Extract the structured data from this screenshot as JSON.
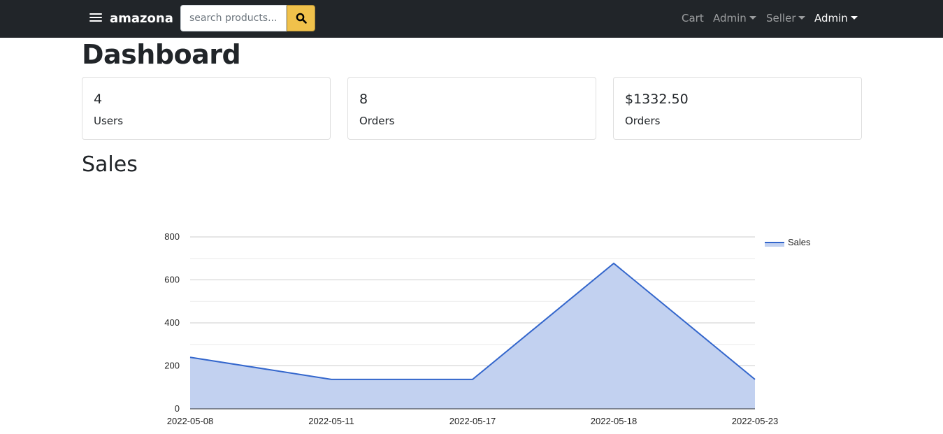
{
  "navbar": {
    "brand": "amazona",
    "search_placeholder": "search products...",
    "links": {
      "cart": "Cart",
      "admin_menu_1": "Admin",
      "seller_menu": "Seller",
      "admin_menu_2": "Admin"
    }
  },
  "page": {
    "title": "Dashboard",
    "sales_heading": "Sales"
  },
  "cards": [
    {
      "value": "4",
      "label": "Users"
    },
    {
      "value": "8",
      "label": "Orders"
    },
    {
      "value": "$1332.50",
      "label": "Orders"
    }
  ],
  "chart_data": {
    "type": "area",
    "categories": [
      "2022-05-08",
      "2022-05-11",
      "2022-05-17",
      "2022-05-18",
      "2022-05-23"
    ],
    "series": [
      {
        "name": "Sales",
        "values": [
          240,
          137,
          137,
          677,
          137
        ]
      }
    ],
    "ylim": [
      0,
      800
    ],
    "yticks": [
      0,
      200,
      400,
      600,
      800
    ],
    "grid": true,
    "legend_position": "right",
    "colors": {
      "line": "#3366cc",
      "fill": "#c2d1f0"
    }
  }
}
